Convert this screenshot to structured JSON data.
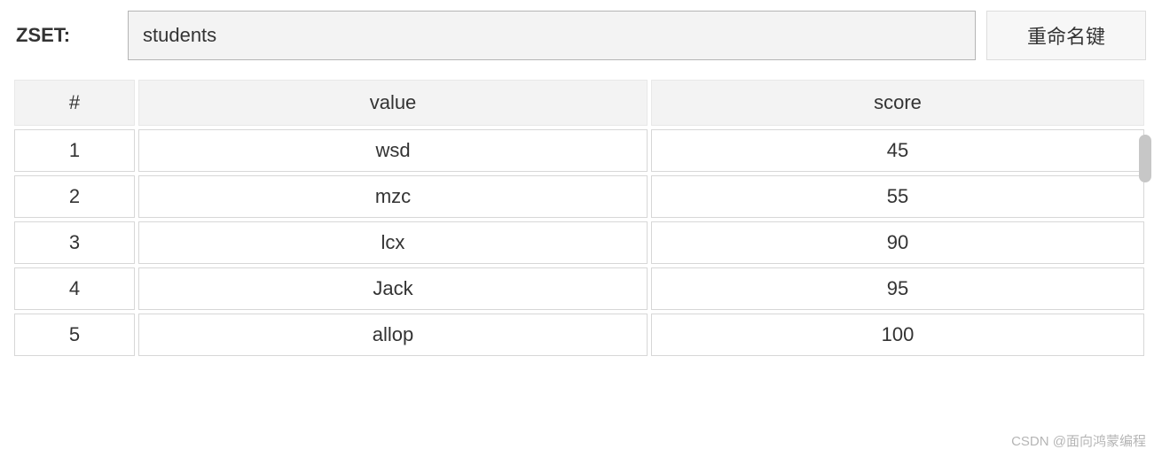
{
  "header": {
    "type_label": "ZSET:",
    "key_value": "students",
    "rename_label": "重命名键"
  },
  "table": {
    "columns": {
      "index": "#",
      "value": "value",
      "score": "score"
    },
    "rows": [
      {
        "index": "1",
        "value": "wsd",
        "score": "45"
      },
      {
        "index": "2",
        "value": "mzc",
        "score": "55"
      },
      {
        "index": "3",
        "value": "lcx",
        "score": "90"
      },
      {
        "index": "4",
        "value": "Jack",
        "score": "95"
      },
      {
        "index": "5",
        "value": "allop",
        "score": "100"
      }
    ]
  },
  "watermark": "CSDN @面向鸿蒙编程"
}
